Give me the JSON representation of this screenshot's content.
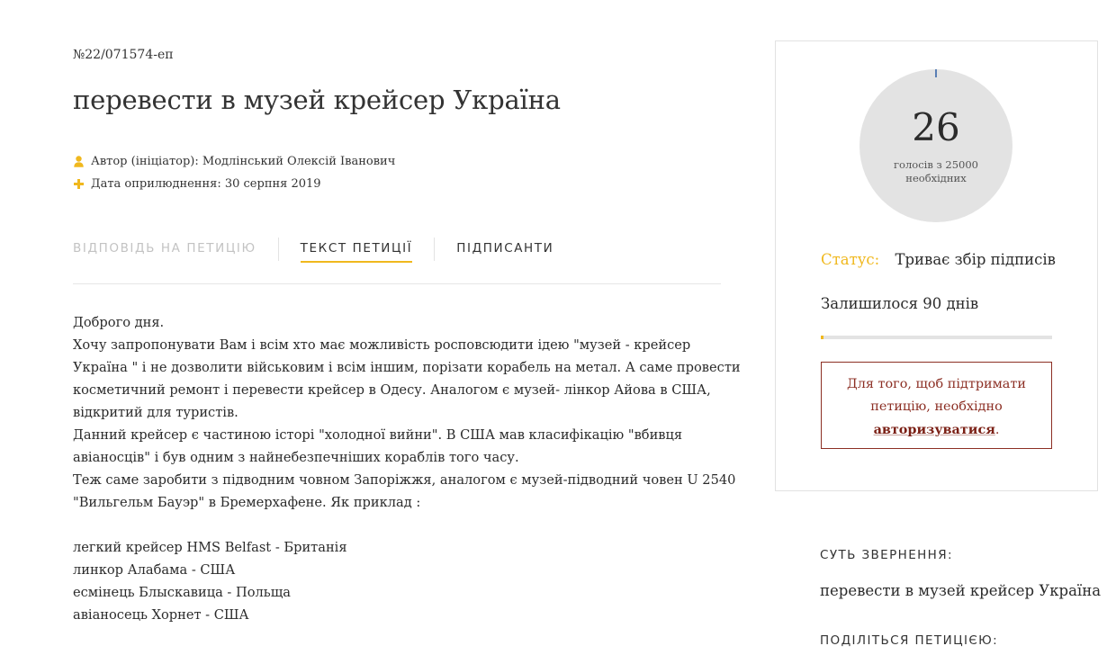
{
  "petition": {
    "number": "№22/071574-еп",
    "title": "перевести в музей крейсер Україна",
    "author_label": "Автор (ініціатор): Модлінський Олексій Іванович",
    "date_label": "Дата оприлюднення: 30 серпня 2019"
  },
  "icons": {
    "author": "user-icon",
    "date": "plus-icon"
  },
  "tabs": [
    {
      "label": "ВІДПОВІДЬ НА ПЕТИЦІЮ",
      "state": "disabled"
    },
    {
      "label": "ТЕКСТ ПЕТИЦІЇ",
      "state": "active"
    },
    {
      "label": "ПІДПИСАНТИ",
      "state": "normal"
    }
  ],
  "body_lines": [
    "Доброго дня.",
    "Хочу запропонувати Вам і всім хто має можливість росповсюдити ідею \"музей - крейсер",
    "Україна \" і не дозволити військовим і всім іншим, порізати корабель на метал. А саме провести",
    "косметичний ремонт і перевести крейсер в Одесу. Аналогом є музей- лінкор Айова в США,",
    "відкритий для туристів.",
    "Данний крейсер є частиною історі \"холодної вийни\". В США мав класифікацію \"вбивця",
    "авіаносців\" і був одним з найнебезпечніших кораблів того часу.",
    "Теж саме заробити з підводним човном Запоріжжя, аналогом є музей-підводний човен U 2540",
    "\"Вильгельм Бауэр\" в Бремерхафене. Як приклад :",
    "",
    "легкий крейсер HMS Belfast - Британія",
    "линкор Алабама - США",
    "есмінець Блыскавица - Польща",
    "авіаносець Хорнет - США"
  ],
  "sidebar": {
    "votes": "26",
    "votes_caption": "голосів з 25000 необхідних",
    "votes_fraction": 0.00104,
    "status_label": "Статус:",
    "status_value": "Триває збір підписів",
    "days_left": "Залишилося 90 днів",
    "auth_text_before": "Для того, щоб підтримати петицію, необхідно",
    "auth_link": "авторизуватися",
    "auth_text_after": "."
  },
  "essence": {
    "label": "СУТЬ ЗВЕРНЕННЯ:",
    "value": "перевести в музей крейсер Україна"
  },
  "share": {
    "label": "ПОДІЛІТЬСЯ ПЕТИЦІЄЮ:"
  },
  "colors": {
    "accent": "#f0b81e",
    "auth_red": "#8c2f24",
    "circle_gray": "#e3e3e3"
  }
}
